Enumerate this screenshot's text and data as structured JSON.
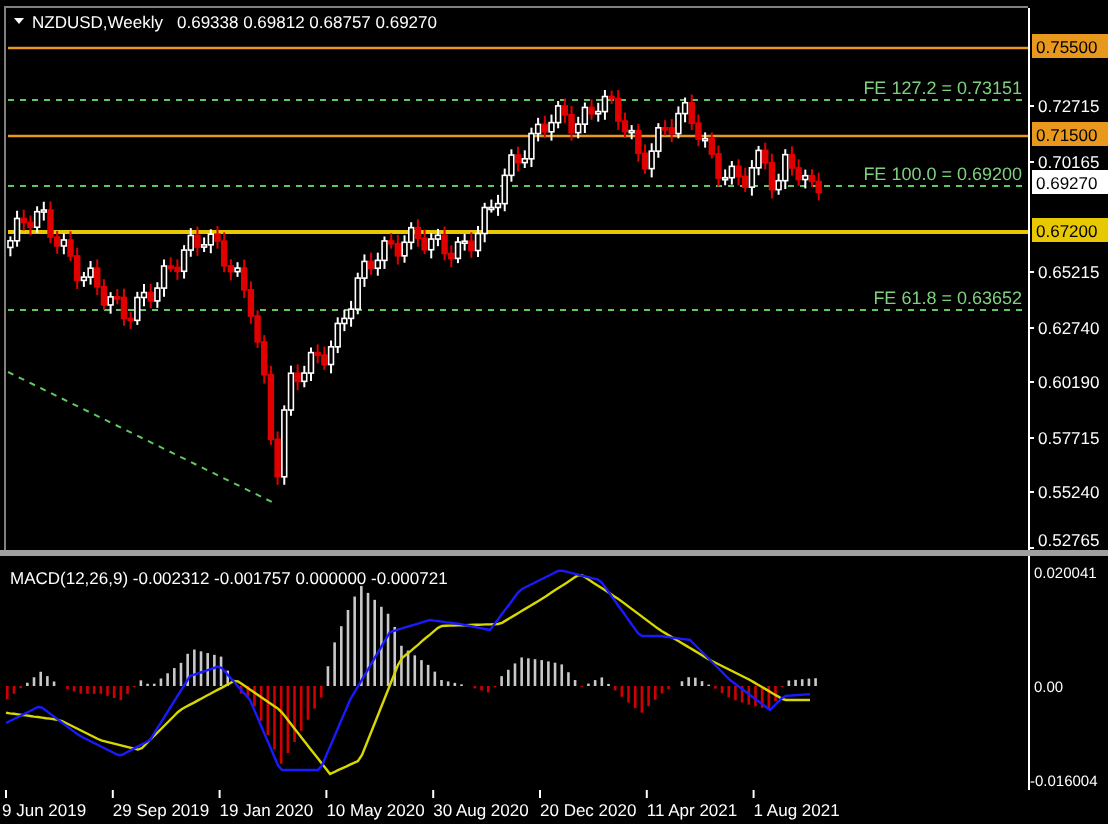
{
  "chart_header": {
    "symbol": "NZDUSD,Weekly",
    "ohlc": "0.69338 0.69812 0.68757 0.69270"
  },
  "price_levels": [
    {
      "kind": "line",
      "color": "#e8981c",
      "tag": "0.75500"
    },
    {
      "kind": "fibo",
      "label": "FE 127.2 = 0.73151"
    },
    {
      "kind": "line",
      "color": "#e8981c",
      "tag": "0.71500"
    },
    {
      "kind": "fibo",
      "label": "FE 100.0 = 0.69200"
    },
    {
      "kind": "current",
      "tag": "0.69270"
    },
    {
      "kind": "line",
      "color": "#e8c800",
      "tag": "0.67200"
    },
    {
      "kind": "fibo",
      "label": "FE 61.8 = 0.63652"
    }
  ],
  "price_axis": [
    "0.72715",
    "0.70165",
    "0.65215",
    "0.62740",
    "0.60190",
    "0.57715",
    "0.55240",
    "0.52765"
  ],
  "macd": {
    "label": "MACD(12,26,9) -0.002312 -0.001757 0.000000 -0.000721",
    "axis": [
      "0.020041",
      "0.00",
      "-0.016004"
    ]
  },
  "time_axis": [
    "9 Jun 2019",
    "29 Sep 2019",
    "19 Jan 2020",
    "10 May 2020",
    "30 Aug 2020",
    "20 Dec 2020",
    "11 Apr 2021",
    "1 Aug 2021"
  ]
}
